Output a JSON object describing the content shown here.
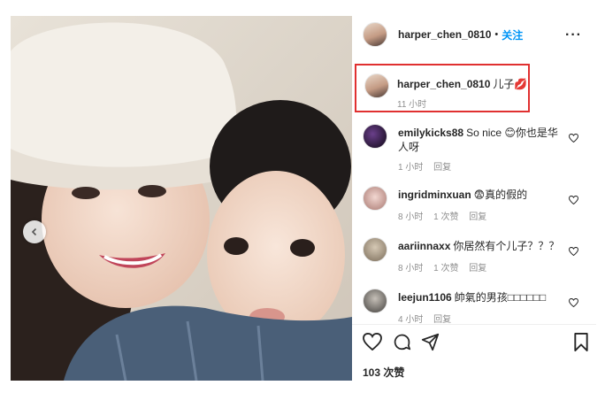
{
  "post": {
    "author": "harper_chen_0810",
    "follow_dot": "•",
    "follow_label": "关注",
    "more_label": "···"
  },
  "caption": {
    "username": "harper_chen_0810",
    "text": "儿子💋",
    "time": "11 小时"
  },
  "comments": [
    {
      "username": "emilykicks88",
      "text": "So nice 😊你也是华人呀",
      "time": "1 小时",
      "likes": "",
      "reply": "回复"
    },
    {
      "username": "ingridminxuan",
      "text": "😨真的假的",
      "time": "8 小时",
      "likes": "1 次赞",
      "reply": "回复"
    },
    {
      "username": "aariinnaxx",
      "text": "你居然有个儿子？？？",
      "time": "8 小时",
      "likes": "1 次赞",
      "reply": "回复"
    },
    {
      "username": "leejun1106",
      "text": "帥氣的男孩□□□□□□",
      "time": "4 小时",
      "likes": "",
      "reply": "回复"
    }
  ],
  "likes_count": "103 次赞",
  "icons": {
    "carousel_prev": "chevron-left-icon",
    "like": "heart-icon",
    "comment": "comment-bubble-icon",
    "share": "send-icon",
    "save": "bookmark-icon",
    "more": "more-horizontal-icon"
  },
  "colors": {
    "follow": "#0095f6",
    "highlight_border": "#e03030",
    "meta_text": "#8e8e8e"
  }
}
